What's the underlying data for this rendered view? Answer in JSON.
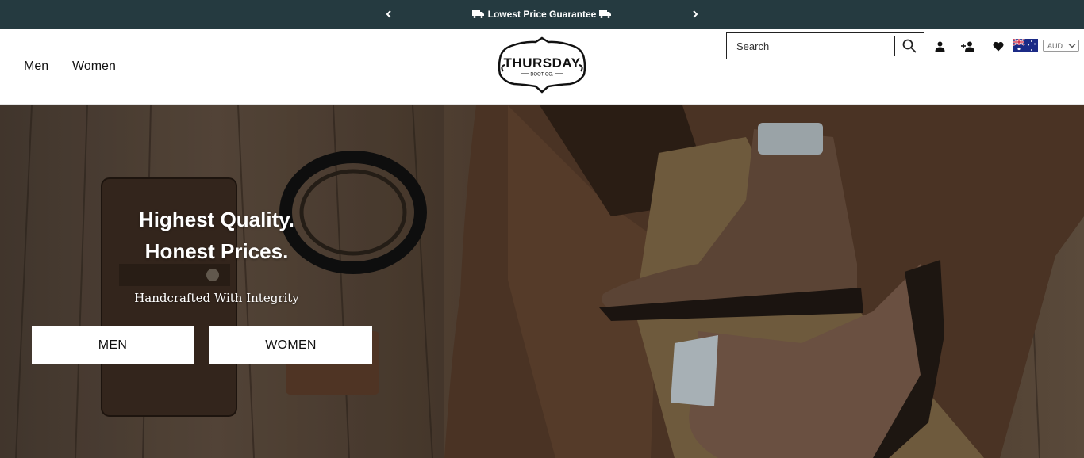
{
  "announcement": {
    "message": "Lowest Price Guarantee",
    "icons": [
      "truck-icon",
      "truck-icon"
    ],
    "prev_icon": "chevron-left-icon",
    "next_icon": "chevron-right-icon",
    "background": "#253a40"
  },
  "nav": {
    "items": [
      {
        "label": "Men"
      },
      {
        "label": "Women"
      }
    ]
  },
  "logo": {
    "name": "THURSDAY",
    "tagline": "BOOT CO."
  },
  "search": {
    "placeholder": "Search",
    "icon": "search-icon"
  },
  "header_icons": [
    "account-icon",
    "add-user-icon",
    "heart-icon"
  ],
  "locale": {
    "flag": "australia-flag-icon",
    "currency": "AUD"
  },
  "hero": {
    "headline_line1": "Highest Quality.",
    "headline_line2": "Honest Prices.",
    "subheadline": "Handcrafted With Integrity",
    "buttons": [
      {
        "label": "MEN"
      },
      {
        "label": "WOMEN"
      }
    ]
  }
}
